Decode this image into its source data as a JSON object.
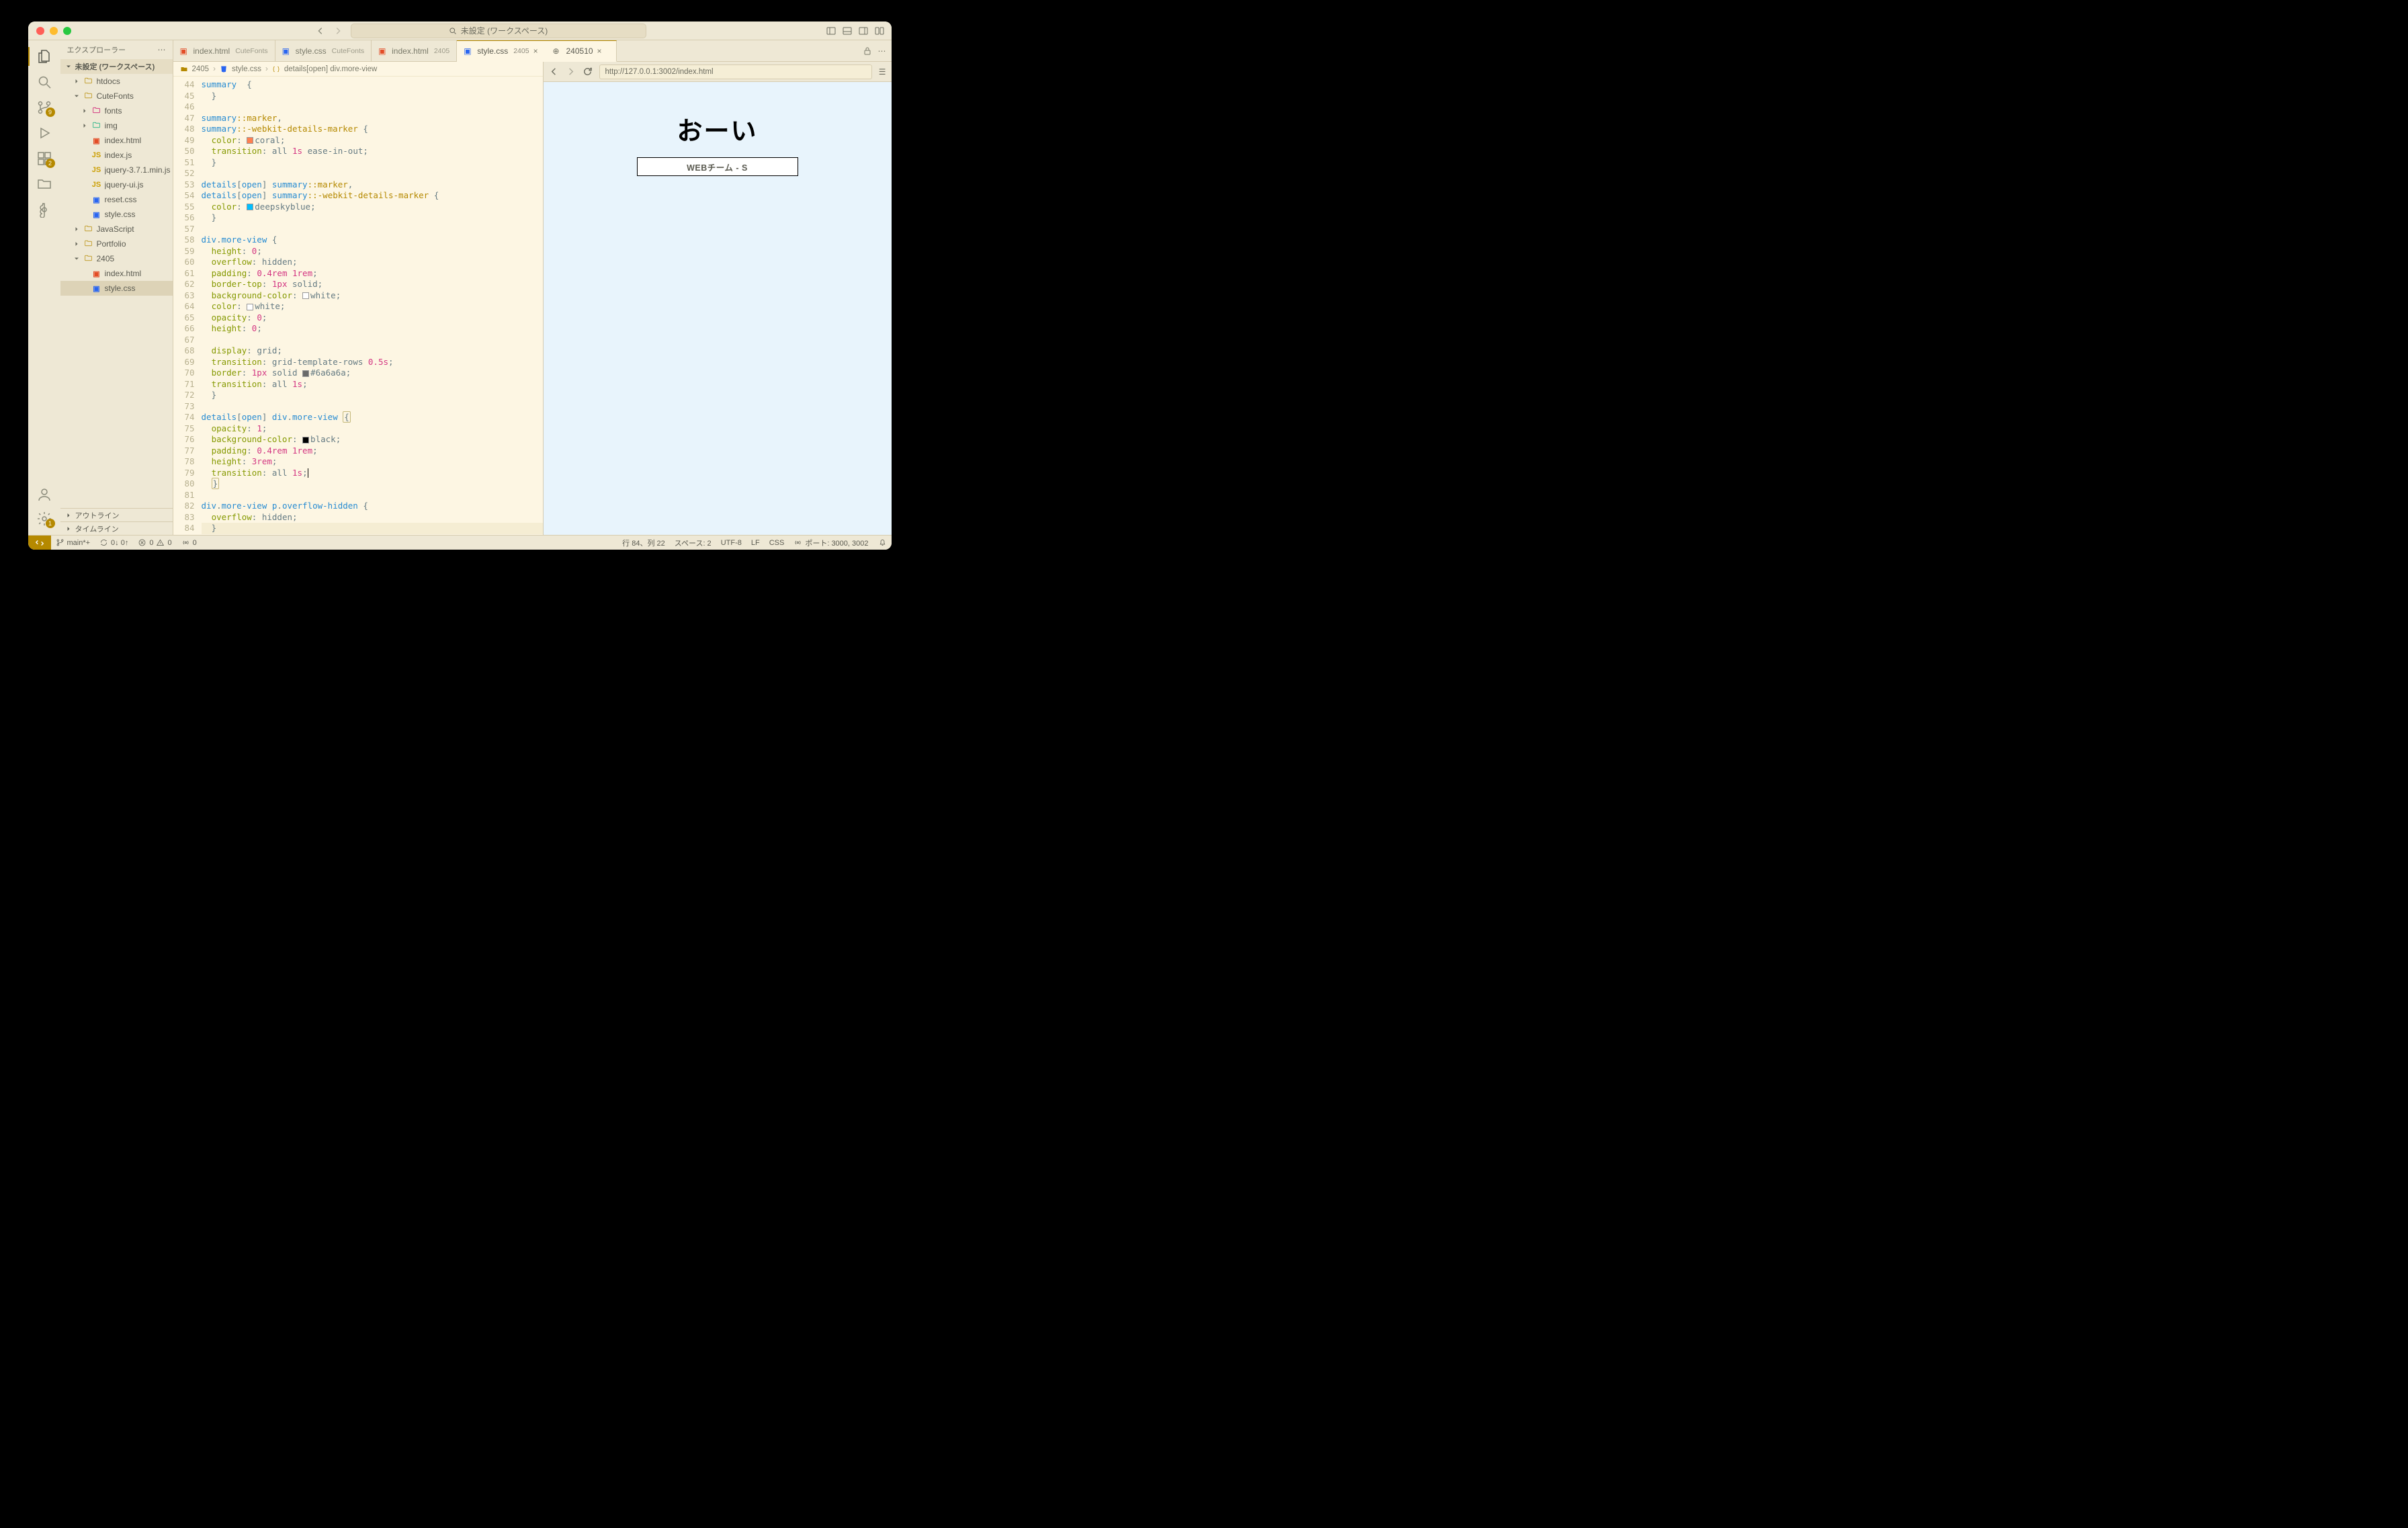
{
  "title": "未設定 (ワークスペース)",
  "search_placeholder": "未設定 (ワークスペース)",
  "sidebar": {
    "header": "エクスプローラー",
    "section": "未設定 (ワークスペース)",
    "outline": "アウトライン",
    "timeline": "タイムライン",
    "tree": [
      {
        "kind": "folder",
        "label": "htdocs",
        "indent": 1,
        "open": false
      },
      {
        "kind": "folder",
        "label": "CuteFonts",
        "indent": 1,
        "open": true
      },
      {
        "kind": "folder",
        "label": "fonts",
        "indent": 2,
        "open": false,
        "iconColor": "#c06"
      },
      {
        "kind": "folder",
        "label": "img",
        "indent": 2,
        "open": false,
        "iconColor": "#0a7"
      },
      {
        "kind": "file",
        "label": "index.html",
        "indent": 2,
        "ic": "html"
      },
      {
        "kind": "file",
        "label": "index.js",
        "indent": 2,
        "ic": "js"
      },
      {
        "kind": "file",
        "label": "jquery-3.7.1.min.js",
        "indent": 2,
        "ic": "js"
      },
      {
        "kind": "file",
        "label": "jquery-ui.js",
        "indent": 2,
        "ic": "js"
      },
      {
        "kind": "file",
        "label": "reset.css",
        "indent": 2,
        "ic": "css"
      },
      {
        "kind": "file",
        "label": "style.css",
        "indent": 2,
        "ic": "css"
      },
      {
        "kind": "folder",
        "label": "JavaScript",
        "indent": 1,
        "open": false
      },
      {
        "kind": "folder",
        "label": "Portfolio",
        "indent": 1,
        "open": false
      },
      {
        "kind": "folder",
        "label": "2405",
        "indent": 1,
        "open": true
      },
      {
        "kind": "file",
        "label": "index.html",
        "indent": 2,
        "ic": "html"
      },
      {
        "kind": "file",
        "label": "style.css",
        "indent": 2,
        "ic": "css",
        "selected": true
      }
    ]
  },
  "tabs": {
    "group1": [
      {
        "label": "index.html",
        "folder": "CuteFonts",
        "ic": "html"
      },
      {
        "label": "style.css",
        "folder": "CuteFonts",
        "ic": "css"
      },
      {
        "label": "index.html",
        "folder": "2405",
        "ic": "html"
      },
      {
        "label": "style.css",
        "folder": "2405",
        "ic": "css",
        "active": true,
        "closable": true
      }
    ],
    "group2": [
      {
        "label": "240510",
        "ic": "globe",
        "active": true,
        "closable": true
      }
    ]
  },
  "breadcrumbs": [
    "2405",
    "style.css",
    "details[open] div.more-view"
  ],
  "code": {
    "start": 44,
    "lines": [
      [
        [
          "sel",
          "summary"
        ],
        [
          "punc",
          "  "
        ],
        [
          "brk",
          "{"
        ]
      ],
      [
        [
          "ind",
          1
        ],
        [
          "brk",
          "}"
        ]
      ],
      [
        [
          "ind",
          1
        ]
      ],
      [
        [
          "sel",
          "summary"
        ],
        [
          "pseudo",
          "::"
        ],
        [
          "pseudo",
          "marker"
        ],
        [
          "punc",
          ","
        ]
      ],
      [
        [
          "sel",
          "summary"
        ],
        [
          "pseudo",
          "::"
        ],
        [
          "pseudo",
          "-webkit-details-marker"
        ],
        [
          "punc",
          " "
        ],
        [
          "brk",
          "{"
        ]
      ],
      [
        [
          "ind",
          1
        ],
        [
          "prop",
          "color"
        ],
        [
          "punc",
          ": "
        ],
        [
          "swatch",
          "#ff7f50"
        ],
        [
          "val",
          "coral"
        ],
        [
          "punc",
          ";"
        ]
      ],
      [
        [
          "ind",
          1
        ],
        [
          "prop",
          "transition"
        ],
        [
          "punc",
          ": "
        ],
        [
          "val",
          "all "
        ],
        [
          "num",
          "1s"
        ],
        [
          "val",
          " ease-in-out"
        ],
        [
          "punc",
          ";"
        ]
      ],
      [
        [
          "ind",
          1
        ],
        [
          "brk",
          "}"
        ]
      ],
      [
        [
          "ind",
          1
        ]
      ],
      [
        [
          "sel",
          "details"
        ],
        [
          "brk",
          "["
        ],
        [
          "attr",
          "open"
        ],
        [
          "brk",
          "]"
        ],
        [
          "punc",
          " "
        ],
        [
          "sel",
          "summary"
        ],
        [
          "pseudo",
          "::"
        ],
        [
          "pseudo",
          "marker"
        ],
        [
          "punc",
          ","
        ]
      ],
      [
        [
          "sel",
          "details"
        ],
        [
          "brk",
          "["
        ],
        [
          "attr",
          "open"
        ],
        [
          "brk",
          "]"
        ],
        [
          "punc",
          " "
        ],
        [
          "sel",
          "summary"
        ],
        [
          "pseudo",
          "::"
        ],
        [
          "pseudo",
          "-webkit-details-marker"
        ],
        [
          "punc",
          " "
        ],
        [
          "brk",
          "{"
        ]
      ],
      [
        [
          "ind",
          1
        ],
        [
          "prop",
          "color"
        ],
        [
          "punc",
          ": "
        ],
        [
          "swatch",
          "#00bfff"
        ],
        [
          "val",
          "deepskyblue"
        ],
        [
          "punc",
          ";"
        ]
      ],
      [
        [
          "ind",
          1
        ],
        [
          "brk",
          "}"
        ]
      ],
      [
        [
          "ind",
          1
        ]
      ],
      [
        [
          "sel",
          "div"
        ],
        [
          "punc",
          "."
        ],
        [
          "sel",
          "more-view"
        ],
        [
          "punc",
          " "
        ],
        [
          "brk",
          "{"
        ]
      ],
      [
        [
          "ind",
          1
        ],
        [
          "prop",
          "height"
        ],
        [
          "punc",
          ": "
        ],
        [
          "num",
          "0"
        ],
        [
          "punc",
          ";"
        ]
      ],
      [
        [
          "ind",
          1
        ],
        [
          "prop",
          "overflow"
        ],
        [
          "punc",
          ": "
        ],
        [
          "val",
          "hidden"
        ],
        [
          "punc",
          ";"
        ]
      ],
      [
        [
          "ind",
          1
        ],
        [
          "prop",
          "padding"
        ],
        [
          "punc",
          ": "
        ],
        [
          "num",
          "0.4rem"
        ],
        [
          "punc",
          " "
        ],
        [
          "num",
          "1rem"
        ],
        [
          "punc",
          ";"
        ]
      ],
      [
        [
          "ind",
          1
        ],
        [
          "prop",
          "border-top"
        ],
        [
          "punc",
          ": "
        ],
        [
          "num",
          "1px"
        ],
        [
          "val",
          " solid"
        ],
        [
          "punc",
          ";"
        ]
      ],
      [
        [
          "ind",
          1
        ],
        [
          "prop",
          "background-color"
        ],
        [
          "punc",
          ": "
        ],
        [
          "swatch",
          "#ffffff"
        ],
        [
          "val",
          "white"
        ],
        [
          "punc",
          ";"
        ]
      ],
      [
        [
          "ind",
          1
        ],
        [
          "prop",
          "color"
        ],
        [
          "punc",
          ": "
        ],
        [
          "swatch",
          "#ffffff"
        ],
        [
          "val",
          "white"
        ],
        [
          "punc",
          ";"
        ]
      ],
      [
        [
          "ind",
          1
        ],
        [
          "prop",
          "opacity"
        ],
        [
          "punc",
          ": "
        ],
        [
          "num",
          "0"
        ],
        [
          "punc",
          ";"
        ]
      ],
      [
        [
          "ind",
          1
        ],
        [
          "prop",
          "height"
        ],
        [
          "punc",
          ": "
        ],
        [
          "num",
          "0"
        ],
        [
          "punc",
          ";"
        ]
      ],
      [
        [
          "ind",
          1
        ]
      ],
      [
        [
          "ind",
          1
        ],
        [
          "prop",
          "display"
        ],
        [
          "punc",
          ": "
        ],
        [
          "val",
          "grid"
        ],
        [
          "punc",
          ";"
        ]
      ],
      [
        [
          "ind",
          1
        ],
        [
          "prop",
          "transition"
        ],
        [
          "punc",
          ": "
        ],
        [
          "val",
          "grid-template-rows "
        ],
        [
          "num",
          "0.5s"
        ],
        [
          "punc",
          ";"
        ]
      ],
      [
        [
          "ind",
          1
        ],
        [
          "prop",
          "border"
        ],
        [
          "punc",
          ": "
        ],
        [
          "num",
          "1px"
        ],
        [
          "val",
          " solid "
        ],
        [
          "swatch",
          "#6a6a6a"
        ],
        [
          "val",
          "#6a6a6a"
        ],
        [
          "punc",
          ";"
        ]
      ],
      [
        [
          "ind",
          1
        ],
        [
          "prop",
          "transition"
        ],
        [
          "punc",
          ": "
        ],
        [
          "val",
          "all "
        ],
        [
          "num",
          "1s"
        ],
        [
          "punc",
          ";"
        ]
      ],
      [
        [
          "ind",
          1
        ],
        [
          "brk",
          "}"
        ]
      ],
      [
        [
          "ind",
          1
        ]
      ],
      [
        [
          "sel",
          "details"
        ],
        [
          "brk",
          "["
        ],
        [
          "attr",
          "open"
        ],
        [
          "brk",
          "]"
        ],
        [
          "punc",
          " "
        ],
        [
          "sel",
          "div"
        ],
        [
          "punc",
          "."
        ],
        [
          "sel",
          "more-view"
        ],
        [
          "punc",
          " "
        ],
        [
          "brkhl",
          "{"
        ]
      ],
      [
        [
          "ind",
          1
        ],
        [
          "prop",
          "opacity"
        ],
        [
          "punc",
          ": "
        ],
        [
          "num",
          "1"
        ],
        [
          "punc",
          ";"
        ]
      ],
      [
        [
          "ind",
          1
        ],
        [
          "prop",
          "background-color"
        ],
        [
          "punc",
          ": "
        ],
        [
          "swatch",
          "#000000"
        ],
        [
          "val",
          "black"
        ],
        [
          "punc",
          ";"
        ]
      ],
      [
        [
          "ind",
          1
        ],
        [
          "prop",
          "padding"
        ],
        [
          "punc",
          ": "
        ],
        [
          "num",
          "0.4rem"
        ],
        [
          "punc",
          " "
        ],
        [
          "num",
          "1rem"
        ],
        [
          "punc",
          ";"
        ]
      ],
      [
        [
          "ind",
          1
        ],
        [
          "prop",
          "height"
        ],
        [
          "punc",
          ": "
        ],
        [
          "num",
          "3rem"
        ],
        [
          "punc",
          ";"
        ]
      ],
      [
        [
          "ind",
          1
        ],
        [
          "prop",
          "transition"
        ],
        [
          "punc",
          ": "
        ],
        [
          "val",
          "all "
        ],
        [
          "num",
          "1s"
        ],
        [
          "punc",
          ";"
        ],
        [
          "cursor",
          ""
        ]
      ],
      [
        [
          "ind",
          1
        ],
        [
          "brkhl",
          "}"
        ]
      ],
      [
        [
          "ind",
          1
        ]
      ],
      [
        [
          "sel",
          "div"
        ],
        [
          "punc",
          "."
        ],
        [
          "sel",
          "more-view"
        ],
        [
          "punc",
          " "
        ],
        [
          "sel",
          "p"
        ],
        [
          "punc",
          "."
        ],
        [
          "sel",
          "overflow-hidden"
        ],
        [
          "punc",
          " "
        ],
        [
          "brk",
          "{"
        ]
      ],
      [
        [
          "ind",
          1
        ],
        [
          "prop",
          "overflow"
        ],
        [
          "punc",
          ": "
        ],
        [
          "val",
          "hidden"
        ],
        [
          "punc",
          ";"
        ]
      ],
      [
        [
          "ind",
          1
        ],
        [
          "brk",
          "}"
        ]
      ]
    ],
    "current_line_index": 40
  },
  "browser": {
    "url": "http://127.0.0.1:3002/index.html",
    "heading": "おーい",
    "button": "WEBチーム - S"
  },
  "status": {
    "branch": "main*+",
    "sync": "0 0",
    "errors": "0",
    "warnings": "0",
    "pos": "行 84、列 22",
    "spaces": "スペース: 2",
    "encoding": "UTF-8",
    "eol": "LF",
    "lang": "CSS",
    "ports": "ポート: 3000, 3002"
  },
  "activity_badges": {
    "scm": "9",
    "ext": "2",
    "settings": "1"
  }
}
